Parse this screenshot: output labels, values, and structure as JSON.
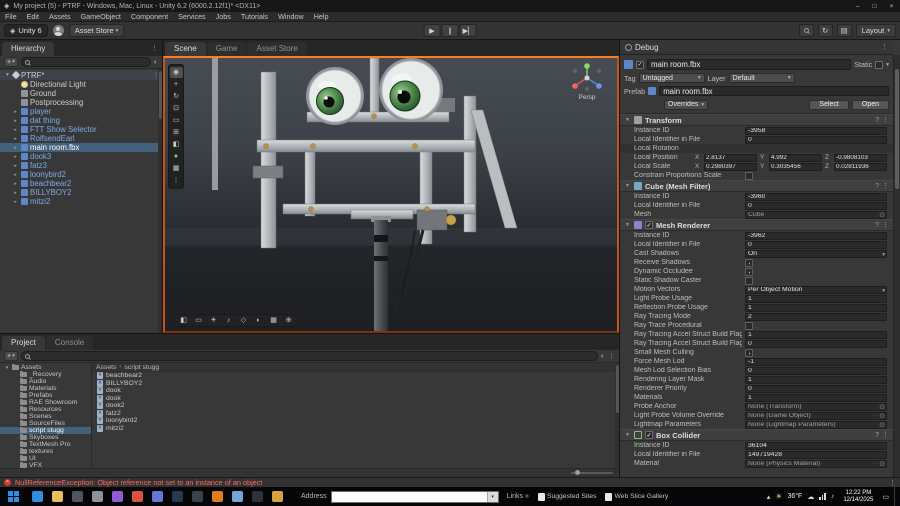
{
  "icons": {
    "app": "◈",
    "minimize": "–",
    "maximize": "□",
    "close": "×",
    "dropdown": "▾",
    "foldout_open": "▼",
    "foldout_closed": "▸",
    "kebab": "⋮",
    "help": "?",
    "check": "✓",
    "objpick": "⊙",
    "plus": "+",
    "play": "▶",
    "pause": "∥",
    "step": "▶▏",
    "breadcrumb_sep": "›",
    "links_chevron": "»",
    "tray_chevron": "▴",
    "sun": "☀",
    "note": "♪",
    "cloud": "☁",
    "action_center": "▭",
    "csharp": "#",
    "error_x": "×"
  },
  "window": {
    "title": "My project (5) - PTRF - Windows, Mac, Linux - Unity 6.2 (6000.2.12f1)* <DX11>"
  },
  "menu": {
    "items": [
      "File",
      "Edit",
      "Assets",
      "GameObject",
      "Component",
      "Services",
      "Jobs",
      "Tutorials",
      "Window",
      "Help"
    ]
  },
  "toolbar": {
    "unity_label": "Unity 6",
    "asset_store_label": "Asset Store",
    "layout_label": "Layout"
  },
  "hierarchy": {
    "tab": "Hierarchy",
    "scene_name": "PTRF*",
    "items": [
      {
        "label": "Directional Light",
        "cls": "",
        "icon": "ico-light",
        "arrow": ""
      },
      {
        "label": "Ground",
        "cls": "",
        "icon": "ico-go",
        "arrow": ""
      },
      {
        "label": "Postprocessing",
        "cls": "",
        "icon": "ico-go",
        "arrow": ""
      },
      {
        "label": "player",
        "cls": "prefab",
        "icon": "ico-prefab",
        "arrow": "▸"
      },
      {
        "label": "dat thing",
        "cls": "prefab",
        "icon": "ico-prefab",
        "arrow": "▸"
      },
      {
        "label": "FTT Show Selector",
        "cls": "prefab",
        "icon": "ico-prefab",
        "arrow": "▸"
      },
      {
        "label": "RolfsendEarl",
        "cls": "prefab",
        "icon": "ico-prefab",
        "arrow": "▸"
      },
      {
        "label": "main room.fbx",
        "cls": "selected",
        "icon": "ico-prefab",
        "arrow": "▸"
      },
      {
        "label": "dook3",
        "cls": "prefab",
        "icon": "ico-prefab",
        "arrow": "▸"
      },
      {
        "label": "fatz3",
        "cls": "prefab",
        "icon": "ico-prefab",
        "arrow": "▸"
      },
      {
        "label": "loonybird2",
        "cls": "prefab",
        "icon": "ico-prefab",
        "arrow": "▸"
      },
      {
        "label": "beachbear2",
        "cls": "prefab",
        "icon": "ico-prefab",
        "arrow": "▸"
      },
      {
        "label": "BILLYBOY2",
        "cls": "prefab",
        "icon": "ico-prefab",
        "arrow": "▸"
      },
      {
        "label": "mitzi2",
        "cls": "prefab",
        "icon": "ico-prefab",
        "arrow": "▸"
      }
    ]
  },
  "scene": {
    "tabs": [
      {
        "label": "Scene",
        "cls": "active"
      },
      {
        "label": "Game",
        "cls": ""
      },
      {
        "label": "Asset Store",
        "cls": ""
      }
    ],
    "gizmo_label": "Persp",
    "tools": [
      {
        "name": "view-tool-icon",
        "glyph": "◉",
        "cls": "active"
      },
      {
        "name": "move-tool-icon",
        "glyph": "+",
        "cls": ""
      },
      {
        "name": "rotate-tool-icon",
        "glyph": "↻",
        "cls": ""
      },
      {
        "name": "scale-tool-icon",
        "glyph": "⊡",
        "cls": ""
      },
      {
        "name": "rect-tool-icon",
        "glyph": "▭",
        "cls": ""
      },
      {
        "name": "transform-tool-icon",
        "glyph": "⊞",
        "cls": ""
      },
      {
        "name": "custom-tool-icon",
        "glyph": "◧",
        "cls": ""
      },
      {
        "name": "snap-toggle-icon",
        "glyph": "●",
        "cls": "green"
      },
      {
        "name": "grid-toggle-icon",
        "glyph": "▦",
        "cls": ""
      },
      {
        "name": "overlay-menu-icon",
        "glyph": "⋮",
        "cls": ""
      }
    ],
    "view_buttons": [
      {
        "name": "draw-mode-icon",
        "glyph": "◧"
      },
      {
        "name": "2d-toggle-icon",
        "glyph": "▭"
      },
      {
        "name": "lighting-toggle-icon",
        "glyph": "☀"
      },
      {
        "name": "audio-toggle-icon",
        "glyph": "♪"
      },
      {
        "name": "effects-toggle-icon",
        "glyph": "◇"
      },
      {
        "name": "visibility-toggle-icon",
        "glyph": "◐"
      },
      {
        "name": "grid-visibility-icon",
        "glyph": "▦"
      },
      {
        "name": "gizmos-menu-icon",
        "glyph": "⊕"
      }
    ]
  },
  "inspector": {
    "tab": "Debug",
    "go": {
      "name": "main room.fbx",
      "static_label": "Static",
      "tag_label": "Tag",
      "tag_value": "Untagged",
      "layer_label": "Layer",
      "layer_value": "Default",
      "prefab_label": "Prefab",
      "prefab_name": "main room.fbx",
      "overrides_label": "Overrides",
      "select_label": "Select",
      "open_label": "Open"
    },
    "transform": {
      "title": "Transform",
      "rows_pre": [
        {
          "label": "Instance ID",
          "value": "-3958",
          "kind": "text"
        },
        {
          "label": "Local Identifier in File",
          "value": "0",
          "kind": "text"
        },
        {
          "label": "Local Rotation",
          "value": "",
          "kind": "labelonly"
        }
      ],
      "position_label": "Local Position",
      "scale_label": "Local Scale",
      "axis_x": "X",
      "axis_y": "Y",
      "axis_z": "Z",
      "position": {
        "x": "2.8137",
        "y": "4.992",
        "z": "-0.9808103"
      },
      "scale": {
        "x": "0.2980397",
        "y": "0.3035456",
        "z": "0.02811936"
      },
      "rows_post": [
        {
          "label": "Constrain Proportions Scale",
          "value": "",
          "kind": "check"
        }
      ]
    },
    "mesh_filter": {
      "title": "Cube (Mesh Filter)",
      "rows": [
        {
          "label": "Instance ID",
          "value": "-3960",
          "kind": "text"
        },
        {
          "label": "Local Identifier in File",
          "value": "0",
          "kind": "text"
        },
        {
          "label": "Mesh",
          "value": "Cube",
          "kind": "object"
        }
      ]
    },
    "mesh_renderer": {
      "title": "Mesh Renderer",
      "rows": [
        {
          "label": "Instance ID",
          "value": "-3962",
          "kind": "text"
        },
        {
          "label": "Local Identifier in File",
          "value": "0",
          "kind": "text"
        },
        {
          "label": "Cast Shadows",
          "value": "On",
          "kind": "dropdown"
        },
        {
          "label": "Receive Shadows",
          "value": "✓",
          "kind": "check"
        },
        {
          "label": "Dynamic Occludee",
          "value": "✓",
          "kind": "check"
        },
        {
          "label": "Static Shadow Caster",
          "value": "",
          "kind": "check"
        },
        {
          "label": "Motion Vectors",
          "value": "Per Object Motion",
          "kind": "dropdown"
        },
        {
          "label": "Light Probe Usage",
          "value": "1",
          "kind": "text"
        },
        {
          "label": "Reflection Probe Usage",
          "value": "1",
          "kind": "text"
        },
        {
          "label": "Ray Tracing Mode",
          "value": "2",
          "kind": "text"
        },
        {
          "label": "Ray Trace Procedural",
          "value": "",
          "kind": "check"
        },
        {
          "label": "Ray Tracing Accel Struct Build Flags ...",
          "value": "1",
          "kind": "text"
        },
        {
          "label": "Ray Tracing Accel Struct Build Flags",
          "value": "0",
          "kind": "text"
        },
        {
          "label": "Small Mesh Culling",
          "value": "✓",
          "kind": "check"
        },
        {
          "label": "Force Mesh Lod",
          "value": "-1",
          "kind": "text"
        },
        {
          "label": "Mesh Lod Selection Bias",
          "value": "0",
          "kind": "text"
        },
        {
          "label": "Rendering Layer Mask",
          "value": "1",
          "kind": "text"
        },
        {
          "label": "Renderer Priority",
          "value": "0",
          "kind": "text"
        },
        {
          "label": "Materials",
          "value": "1",
          "kind": "text"
        },
        {
          "label": "Probe Anchor",
          "value": "None (Transform)",
          "kind": "object"
        },
        {
          "label": "Light Probe Volume Override",
          "value": "None (Game Object)",
          "kind": "object"
        },
        {
          "label": "Lightmap Parameters",
          "value": "None (Lightmap Parameters)",
          "kind": "object"
        }
      ]
    },
    "box_collider": {
      "title": "Box Collider",
      "rows": [
        {
          "label": "Instance ID",
          "value": "36104",
          "kind": "text"
        },
        {
          "label": "Local Identifier in File",
          "value": "149719428",
          "kind": "text"
        },
        {
          "label": "Material",
          "value": "None (Physics Material)",
          "kind": "object"
        }
      ]
    }
  },
  "project": {
    "tabs": [
      {
        "label": "Project",
        "cls": "active"
      },
      {
        "label": "Console",
        "cls": ""
      }
    ],
    "root_label": "Assets",
    "folders": [
      {
        "label": "_Recovery",
        "arrow": ""
      },
      {
        "label": "Audio",
        "arrow": ""
      },
      {
        "label": "Materials",
        "arrow": ""
      },
      {
        "label": "Prefabs",
        "arrow": ""
      },
      {
        "label": "RAE Showroom",
        "arrow": ""
      },
      {
        "label": "Resources",
        "arrow": ""
      },
      {
        "label": "Scenes",
        "arrow": ""
      },
      {
        "label": "SourceFiles",
        "arrow": ""
      },
      {
        "label": "script stugg",
        "arrow": "",
        "cls": "selected"
      },
      {
        "label": "Skyboxes",
        "arrow": ""
      },
      {
        "label": "TextMesh Pro",
        "arrow": ""
      },
      {
        "label": "textures",
        "arrow": ""
      },
      {
        "label": "UI",
        "arrow": ""
      },
      {
        "label": "VFX",
        "arrow": ""
      }
    ],
    "breadcrumb_current": "script stugg",
    "files": [
      "beachbear2",
      "BILLYBOY2",
      "dook",
      "dook",
      "dook2",
      "fatz2",
      "loonybird2",
      "mitzi2"
    ]
  },
  "statusbar": {
    "error_message": "NullReferenceException: Object reference not set to an instance of an object"
  },
  "taskbar": {
    "address_label": "Address",
    "links_label": "Links",
    "suggested_label": "Suggested Sites",
    "webslice_label": "Web Slice Gallery",
    "temperature": "36°F",
    "time": "12:22 PM",
    "date": "12/14/2025",
    "apps": [
      {
        "name": "edge-browser-icon",
        "color": "#2e8ee0"
      },
      {
        "name": "file-explorer-icon",
        "color": "#e8c05a"
      },
      {
        "name": "unity-hub-icon",
        "color": "#4e5560"
      },
      {
        "name": "unity-editor-icon",
        "color": "#8d939c"
      },
      {
        "name": "visual-studio-icon",
        "color": "#915bd4"
      },
      {
        "name": "chrome-browser-icon",
        "color": "#d8543f"
      },
      {
        "name": "discord-icon",
        "color": "#6577d8"
      },
      {
        "name": "steam-icon",
        "color": "#28394e"
      },
      {
        "name": "obs-icon",
        "color": "#39414a"
      },
      {
        "name": "vlc-player-icon",
        "color": "#e07b1f"
      },
      {
        "name": "notepad-icon",
        "color": "#73a6d8"
      },
      {
        "name": "terminal-icon",
        "color": "#2f3136"
      },
      {
        "name": "paint-icon",
        "color": "#d8a23f"
      }
    ]
  }
}
